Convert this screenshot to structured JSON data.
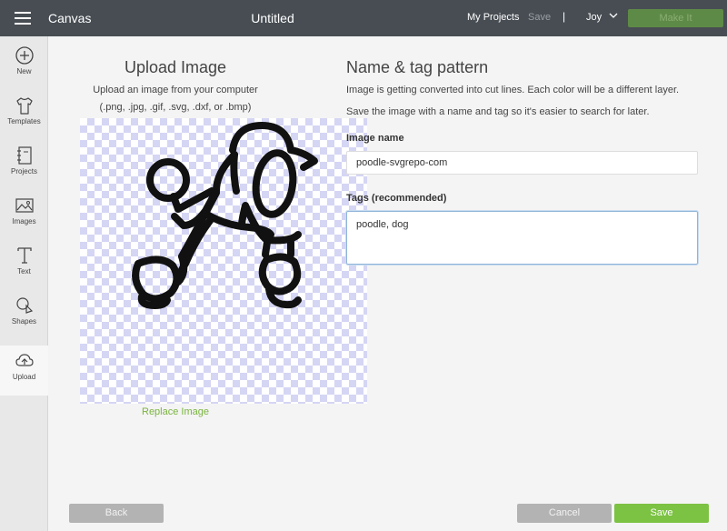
{
  "header": {
    "app_name": "Canvas",
    "doc_title": "Untitled",
    "my_projects": "My Projects",
    "save": "Save",
    "separator": "|",
    "user": "Joy",
    "make_it": "Make It"
  },
  "sidebar": {
    "items": [
      {
        "label": "New",
        "icon": "plus-circle-icon"
      },
      {
        "label": "Templates",
        "icon": "shirt-icon"
      },
      {
        "label": "Projects",
        "icon": "notebook-icon"
      },
      {
        "label": "Images",
        "icon": "image-icon"
      },
      {
        "label": "Text",
        "icon": "text-icon"
      },
      {
        "label": "Shapes",
        "icon": "shapes-icon"
      },
      {
        "label": "Upload",
        "icon": "cloud-upload-icon"
      }
    ],
    "active": "Upload"
  },
  "upload": {
    "title": "Upload Image",
    "desc1": "Upload an image from your computer",
    "desc2": "(.png, .jpg, .gif, .svg, .dxf, or .bmp)",
    "replace": "Replace Image"
  },
  "form": {
    "title": "Name & tag pattern",
    "info1": "Image is getting converted into cut lines. Each color will be a different layer.",
    "info2": "Save the image with a name and tag so it's easier to search for later.",
    "name_label": "Image name",
    "name_value": "poodle-svgrepo-com",
    "tags_label": "Tags (recommended)",
    "tags_value": "poodle, dog"
  },
  "footer": {
    "back": "Back",
    "cancel": "Cancel",
    "save": "Save"
  },
  "colors": {
    "topbar": "#474d53",
    "accent_green": "#7cc243",
    "link_green": "#7ab33f",
    "checker": "#d5d5f4"
  }
}
